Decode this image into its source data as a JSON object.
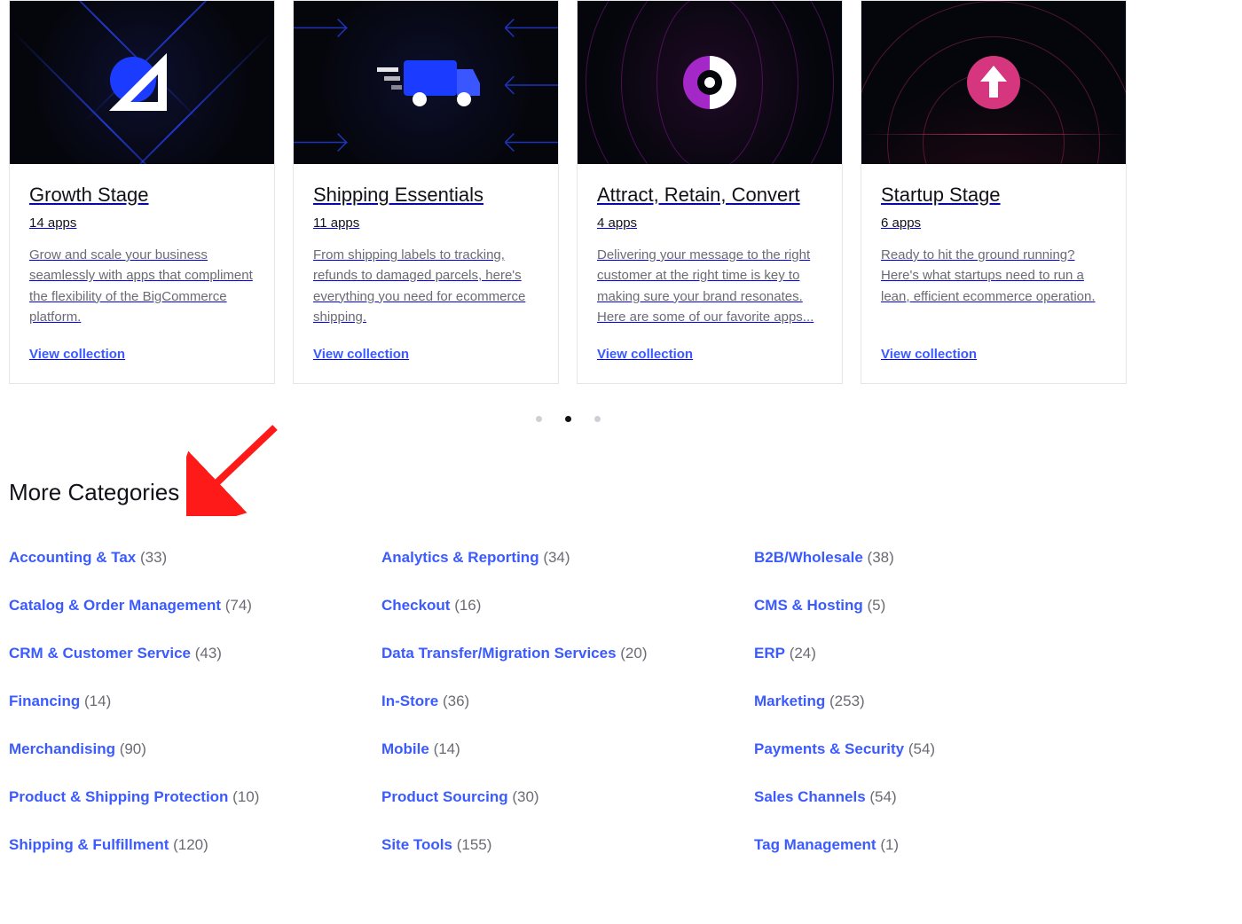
{
  "cards": [
    {
      "title": "Growth Stage",
      "apps": "14 apps",
      "desc": "Grow and scale your business seamlessly with apps that compliment the flexibility of the BigCommerce platform.",
      "link": "View collection"
    },
    {
      "title": "Shipping Essentials",
      "apps": "11 apps",
      "desc": "From shipping labels to tracking, refunds to damaged parcels, here's everything you need for ecommerce shipping.",
      "link": "View collection"
    },
    {
      "title": "Attract, Retain, Convert",
      "apps": "4 apps",
      "desc": "Delivering your message to the right customer at the right time is key to making sure your brand resonates. Here are some of our favorite apps...",
      "link": "View collection"
    },
    {
      "title": "Startup Stage",
      "apps": "6 apps",
      "desc": "Ready to hit the ground running? Here's what startups need to run a lean, efficient ecommerce operation.",
      "link": "View collection"
    }
  ],
  "pagination": {
    "total": 3,
    "active": 1
  },
  "more_categories_title": "More Categories",
  "categories": [
    {
      "name": "Accounting & Tax",
      "count": "(33)"
    },
    {
      "name": "Analytics & Reporting",
      "count": "(34)"
    },
    {
      "name": "B2B/Wholesale",
      "count": "(38)"
    },
    {
      "name": "Catalog & Order Management",
      "count": "(74)"
    },
    {
      "name": "Checkout",
      "count": "(16)"
    },
    {
      "name": "CMS & Hosting",
      "count": "(5)"
    },
    {
      "name": "CRM & Customer Service",
      "count": "(43)"
    },
    {
      "name": "Data Transfer/Migration Services",
      "count": "(20)"
    },
    {
      "name": "ERP",
      "count": "(24)"
    },
    {
      "name": "Financing",
      "count": "(14)"
    },
    {
      "name": "In-Store",
      "count": "(36)"
    },
    {
      "name": "Marketing",
      "count": "(253)"
    },
    {
      "name": "Merchandising",
      "count": "(90)"
    },
    {
      "name": "Mobile",
      "count": "(14)"
    },
    {
      "name": "Payments & Security",
      "count": "(54)"
    },
    {
      "name": "Product & Shipping Protection",
      "count": "(10)"
    },
    {
      "name": "Product Sourcing",
      "count": "(30)"
    },
    {
      "name": "Sales Channels",
      "count": "(54)"
    },
    {
      "name": "Shipping & Fulfillment",
      "count": "(120)"
    },
    {
      "name": "Site Tools",
      "count": "(155)"
    },
    {
      "name": "Tag Management",
      "count": "(1)"
    }
  ]
}
